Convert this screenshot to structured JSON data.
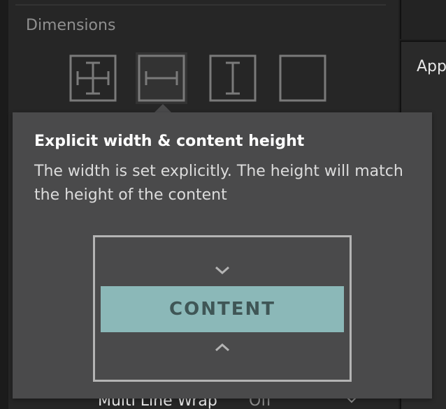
{
  "section": {
    "title": "Dimensions"
  },
  "dimension_buttons": [
    {
      "icon": "fixed-size-icon",
      "selected": false
    },
    {
      "icon": "fixed-width-icon",
      "selected": true
    },
    {
      "icon": "fixed-height-icon",
      "selected": false
    },
    {
      "icon": "content-size-icon",
      "selected": false
    }
  ],
  "right_panel": {
    "label": "App"
  },
  "tooltip": {
    "title": "Explicit width & content height",
    "description": "The width is set explicitly. The height will match the height of the content",
    "diagram": {
      "content_label": "CONTENT"
    }
  },
  "behind_row": {
    "label": "Multi Line Wrap",
    "value": "Off"
  },
  "colors": {
    "tooltip_bg": "#4a4a4b",
    "content_fill": "#8bb8b8",
    "content_text": "#3f5656",
    "panel_bg": "#262626"
  }
}
